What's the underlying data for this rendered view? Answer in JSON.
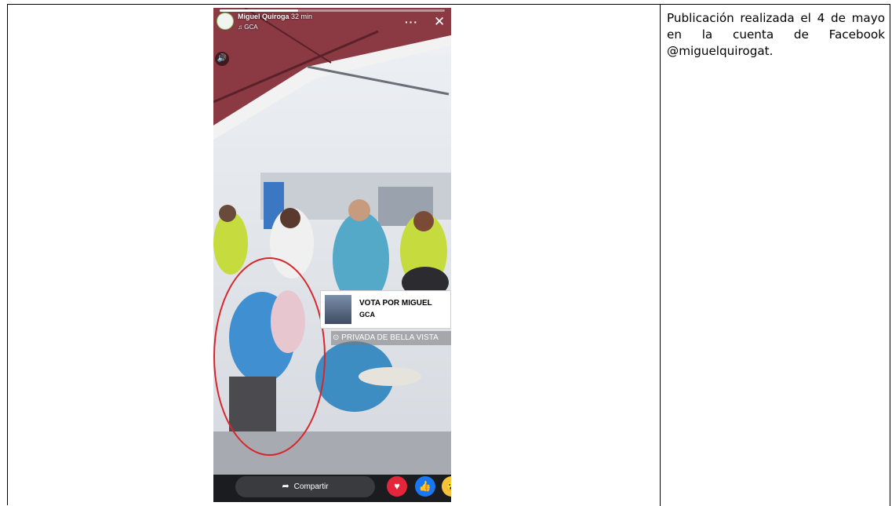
{
  "caption": {
    "text": "Publicación realizada el 4 de mayo en la cuenta de Facebook @miguelquirogat."
  },
  "story": {
    "author": "Miguel Quiroga",
    "time": "32 min",
    "music_label": "GCA",
    "more_icon": "ellipsis-icon",
    "close_icon": "close-icon",
    "sound_icon": "speaker-icon",
    "sticker": {
      "title": "VOTA POR MIGUEL",
      "subtitle": "GCA"
    },
    "location_label": "PRIVADA DE BELLA VISTA",
    "share_label": "Compartir",
    "reactions": [
      "love-reaction-icon",
      "like-reaction-icon",
      "wow-reaction-icon"
    ],
    "progress_fraction": 0.35,
    "highlight_color": "#d8252b"
  }
}
